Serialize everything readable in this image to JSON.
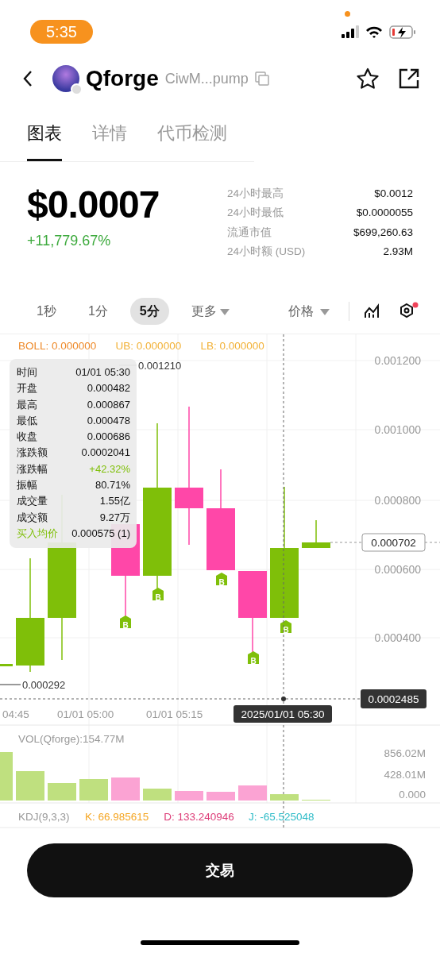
{
  "status_bar": {
    "time": "5:35"
  },
  "header": {
    "name": "Qforge",
    "address": "CiwM...pump"
  },
  "tabs": [
    {
      "label": "图表",
      "selected": true
    },
    {
      "label": "详情",
      "selected": false
    },
    {
      "label": "代币检测",
      "selected": false
    }
  ],
  "price": {
    "value": "$0.0007",
    "change": "+11,779.67%"
  },
  "stats": [
    {
      "label": "24小时最高",
      "value": "$0.0012"
    },
    {
      "label": "24小时最低",
      "value": "$0.0000055"
    },
    {
      "label": "流通市值",
      "value": "$699,260.63"
    },
    {
      "label": "24小时额 (USD)",
      "value": "2.93M"
    }
  ],
  "intervals": [
    {
      "label": "1秒",
      "selected": false,
      "dropdown": false
    },
    {
      "label": "1分",
      "selected": false,
      "dropdown": false
    },
    {
      "label": "5分",
      "selected": true,
      "dropdown": false
    },
    {
      "label": "更多",
      "selected": false,
      "dropdown": true
    }
  ],
  "price_mode": {
    "label": "价格"
  },
  "chart": {
    "indicators": [
      {
        "text": "BOLL: 0.000000",
        "kind": "main"
      },
      {
        "text": "UB: 0.000000",
        "kind": "band"
      },
      {
        "text": "LB: 0.000000",
        "kind": "band"
      }
    ],
    "y_ticks": [
      "0.001200",
      "0.001000",
      "0.000800",
      "0.000600",
      "0.000400"
    ],
    "high_marker": "0.001210",
    "low_marker": "0.000292",
    "last_price": "0.000702",
    "crosshair_price": "0.0002485",
    "crosshair_time": "2025/01/01 05:30",
    "x_labels": [
      "04:45",
      "01/01 05:00",
      "01/01 05:15"
    ],
    "buy_marks": [
      "B",
      "B",
      "B",
      "B",
      "B"
    ]
  },
  "tooltip": [
    {
      "label": "时间",
      "value": "01/01 05:30",
      "kind": "plain"
    },
    {
      "label": "开盘",
      "value": "0.000482",
      "kind": "plain"
    },
    {
      "label": "最高",
      "value": "0.000867",
      "kind": "plain"
    },
    {
      "label": "最低",
      "value": "0.000478",
      "kind": "plain"
    },
    {
      "label": "收盘",
      "value": "0.000686",
      "kind": "plain"
    },
    {
      "label": "涨跌额",
      "value": "0.0002041",
      "kind": "plain"
    },
    {
      "label": "涨跌幅",
      "value": "+42.32%",
      "kind": "change"
    },
    {
      "label": "振幅",
      "value": "80.71%",
      "kind": "plain"
    },
    {
      "label": "成交量",
      "value": "1.55亿",
      "kind": "plain"
    },
    {
      "label": "成交额",
      "value": "9.27万",
      "kind": "plain"
    },
    {
      "label": "买入均价",
      "value": "0.000575 (1)",
      "kind": "avg"
    }
  ],
  "volume": {
    "label": "VOL(Qforge):154.77M",
    "y_ticks": [
      "856.02M",
      "428.01M",
      "0.000"
    ]
  },
  "kdj": [
    {
      "text": "KDJ(9,3,3)",
      "kind": "name"
    },
    {
      "text": "K: 66.985615",
      "kind": "k"
    },
    {
      "text": "D: 133.240946",
      "kind": "d"
    },
    {
      "text": "J: -65.525048",
      "kind": "j"
    }
  ],
  "trade_button": {
    "label": "交易"
  }
}
